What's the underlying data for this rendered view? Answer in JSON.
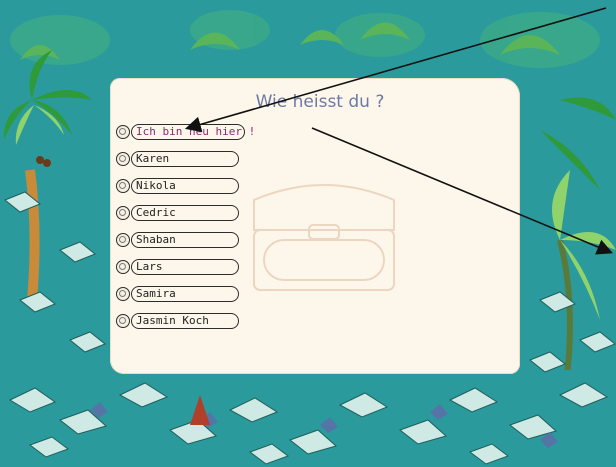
{
  "dialog": {
    "title": "Wie heisst du ?"
  },
  "names": [
    {
      "label": "Ich bin neu hier !",
      "kind": "new"
    },
    {
      "label": "Karen",
      "kind": "user"
    },
    {
      "label": "Nikola",
      "kind": "user"
    },
    {
      "label": "Cedric",
      "kind": "user"
    },
    {
      "label": "Shaban",
      "kind": "user"
    },
    {
      "label": "Lars",
      "kind": "user"
    },
    {
      "label": "Samira",
      "kind": "user"
    },
    {
      "label": "Jasmin Koch",
      "kind": "user"
    }
  ],
  "colors": {
    "background": "#2a9a9c",
    "panel": "#fdf6ea",
    "title": "#6c78a8",
    "new_entry_text": "#8a2a76"
  }
}
